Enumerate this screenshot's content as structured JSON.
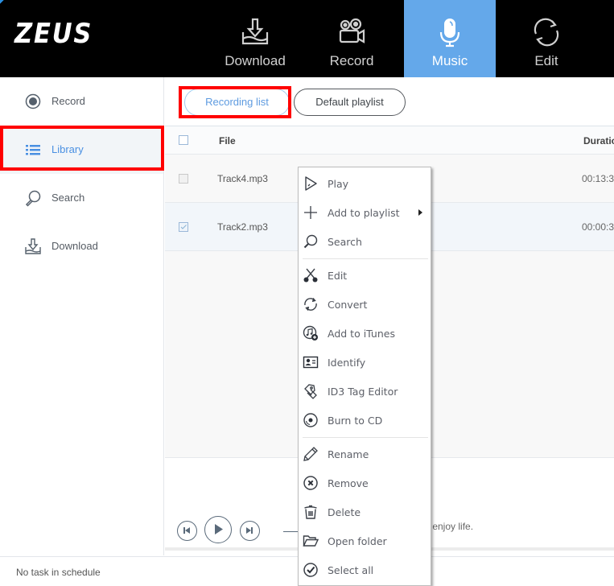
{
  "app": {
    "logo": "ZEUS",
    "accent_color": "#64a8ea",
    "highlight_color": "#ff0000"
  },
  "topnav": {
    "tabs": [
      {
        "label": "Download",
        "icon": "download-icon",
        "active": false
      },
      {
        "label": "Record",
        "icon": "video-camera-icon",
        "active": false
      },
      {
        "label": "Music",
        "icon": "microphone-icon",
        "active": true
      },
      {
        "label": "Edit",
        "icon": "convert-cycle-icon",
        "active": false
      }
    ]
  },
  "sidebar": {
    "items": [
      {
        "label": "Record",
        "icon": "record-icon",
        "active": false
      },
      {
        "label": "Library",
        "icon": "list-icon",
        "active": true
      },
      {
        "label": "Search",
        "icon": "search-icon",
        "active": false
      },
      {
        "label": "Download",
        "icon": "download-icon",
        "active": false
      }
    ]
  },
  "main": {
    "tabs": [
      {
        "label": "Recording list",
        "active": true
      },
      {
        "label": "Default playlist",
        "active": false
      }
    ],
    "table": {
      "columns": [
        "File",
        "Duratio"
      ],
      "rows": [
        {
          "file": "Track4.mp3",
          "duration": "00:13:3",
          "checked": false
        },
        {
          "file": "Track2.mp3",
          "duration": "00:00:3",
          "checked": true
        }
      ]
    },
    "player": {
      "tagline": "sic, enjoy life."
    }
  },
  "context_menu": {
    "items": [
      {
        "label": "Play",
        "icon": "play-icon"
      },
      {
        "label": "Add to playlist",
        "icon": "plus-icon",
        "submenu": true
      },
      {
        "label": "Search",
        "icon": "search-icon"
      },
      {
        "label": "Edit",
        "icon": "scissors-icon"
      },
      {
        "label": "Convert",
        "icon": "convert-icon"
      },
      {
        "label": "Add to iTunes",
        "icon": "itunes-add-icon"
      },
      {
        "label": "Identify",
        "icon": "id-card-icon"
      },
      {
        "label": "ID3 Tag Editor",
        "icon": "tag-edit-icon"
      },
      {
        "label": "Burn to CD",
        "icon": "cd-icon"
      },
      {
        "label": "Rename",
        "icon": "pencil-icon"
      },
      {
        "label": "Remove",
        "icon": "remove-circle-icon"
      },
      {
        "label": "Delete",
        "icon": "trash-icon"
      },
      {
        "label": "Open folder",
        "icon": "folder-open-icon"
      },
      {
        "label": "Select all",
        "icon": "check-circle-icon"
      }
    ]
  },
  "statusbar": {
    "text": "No task in schedule"
  }
}
